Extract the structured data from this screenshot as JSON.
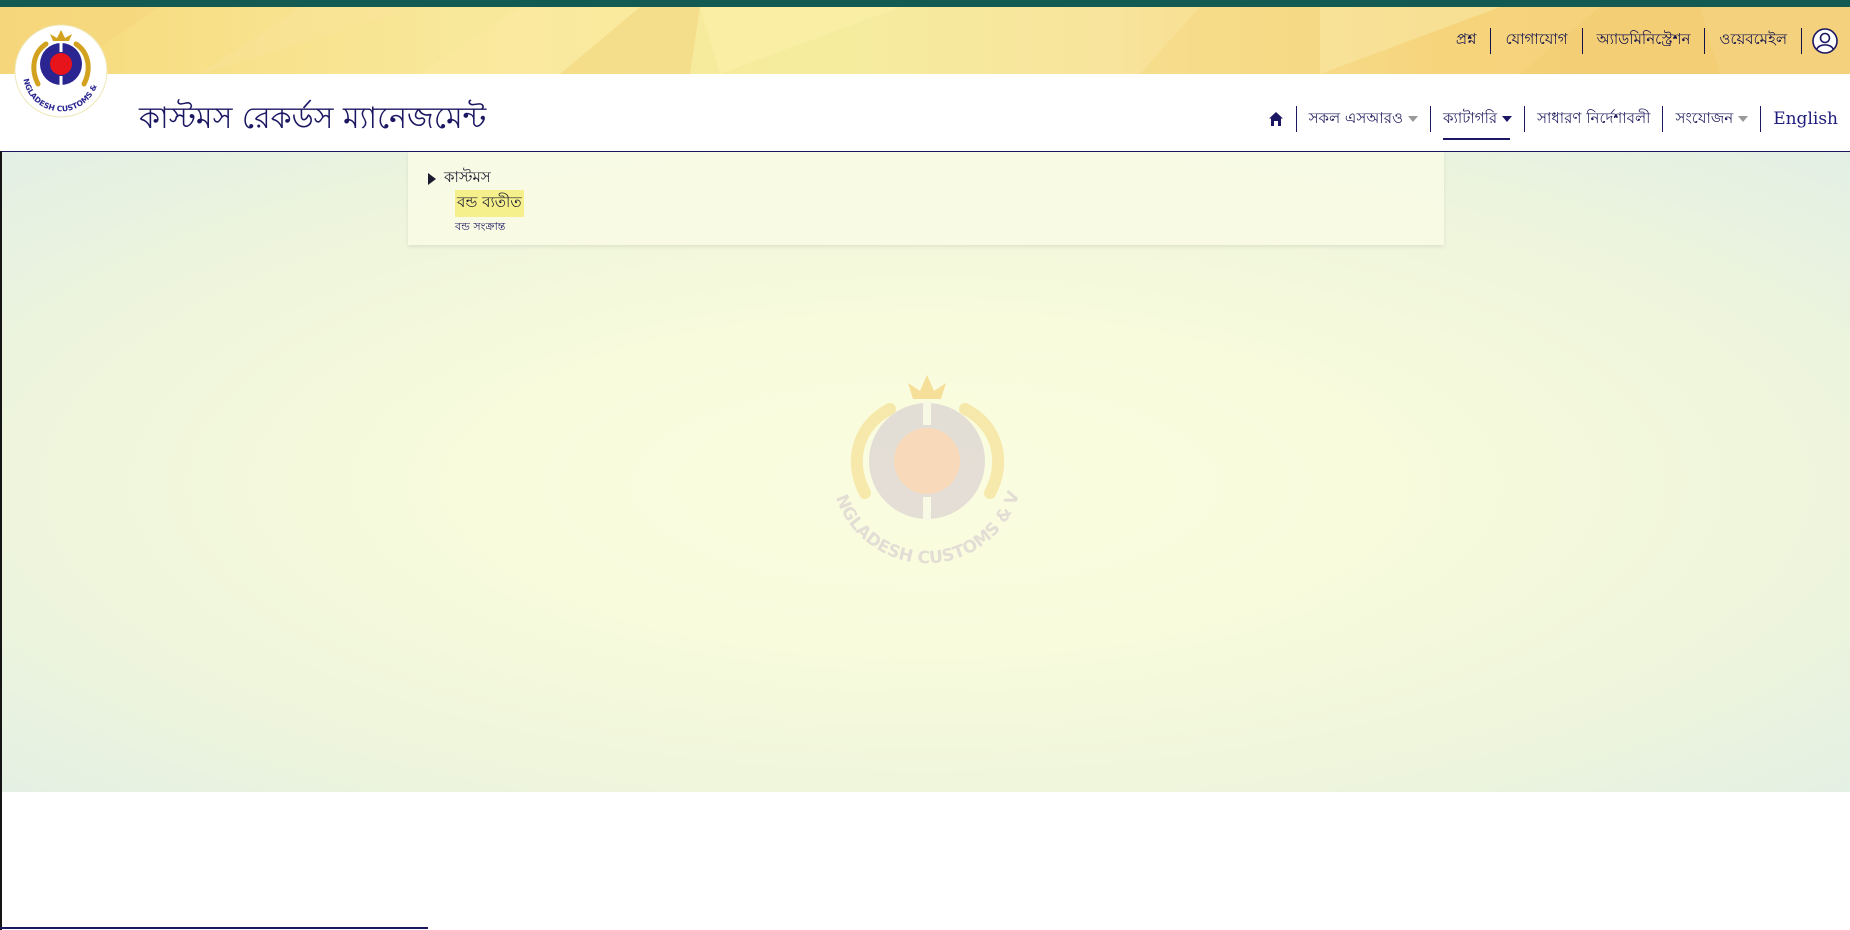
{
  "top_links": [
    "প্রশ্ন",
    "যোগাযোগ",
    "অ্যাডমিনিস্ট্রেশন",
    "ওয়েবমেইল"
  ],
  "site_title": "কাস্টমস রেকর্ডস ম্যানেজমেন্ট",
  "logo_text": "BANGLADESH CUSTOMS & VAT",
  "nav": {
    "all_sros": "সকল এসআরও",
    "category": "ক্যাটাগরি",
    "general_instructions": "সাধারণ নির্দেশাবলী",
    "attachment": "সংযোজন",
    "language": "English"
  },
  "dropdown": {
    "parent": "কাস্টমস",
    "children": [
      "বন্ড ব্যতীত",
      "বন্ড সংক্রান্ত"
    ]
  },
  "colors": {
    "brand_navy": "#1b1762",
    "top_strip": "#135a52",
    "highlight": "#f6f08c"
  },
  "icons": [
    "home-icon",
    "user-icon",
    "caret-down-icon",
    "triangle-right-icon"
  ]
}
